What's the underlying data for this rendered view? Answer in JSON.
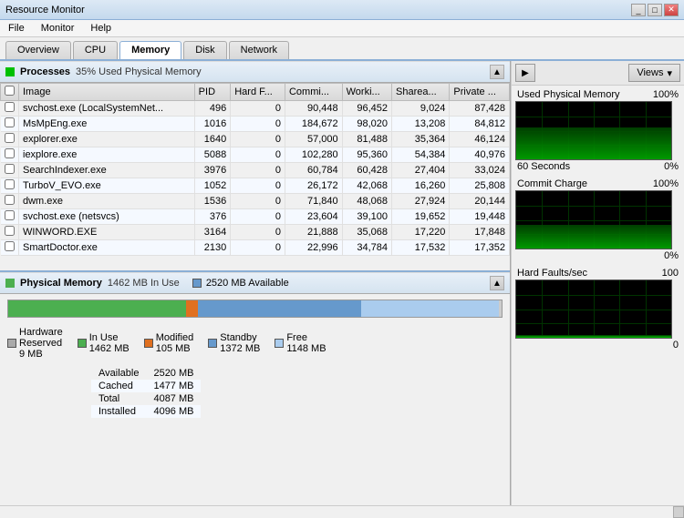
{
  "titleBar": {
    "title": "Resource Monitor",
    "minimizeLabel": "_",
    "maximizeLabel": "□",
    "closeLabel": "✕"
  },
  "menu": {
    "items": [
      "File",
      "Monitor",
      "Help"
    ]
  },
  "tabs": [
    {
      "label": "Overview",
      "active": false
    },
    {
      "label": "CPU",
      "active": false
    },
    {
      "label": "Memory",
      "active": true
    },
    {
      "label": "Disk",
      "active": false
    },
    {
      "label": "Network",
      "active": false
    }
  ],
  "processesSection": {
    "title": "Processes",
    "statusText": "35% Used Physical Memory",
    "columns": [
      "Image",
      "PID",
      "Hard F...",
      "Commi...",
      "Worki...",
      "Sharea...",
      "Private ..."
    ],
    "rows": [
      [
        "svchost.exe (LocalSystemNet...",
        "496",
        "0",
        "90,448",
        "96,452",
        "9,024",
        "87,428"
      ],
      [
        "MsMpEng.exe",
        "1016",
        "0",
        "184,672",
        "98,020",
        "13,208",
        "84,812"
      ],
      [
        "explorer.exe",
        "1640",
        "0",
        "57,000",
        "81,488",
        "35,364",
        "46,124"
      ],
      [
        "iexplore.exe",
        "5088",
        "0",
        "102,280",
        "95,360",
        "54,384",
        "40,976"
      ],
      [
        "SearchIndexer.exe",
        "3976",
        "0",
        "60,784",
        "60,428",
        "27,404",
        "33,024"
      ],
      [
        "TurboV_EVO.exe",
        "1052",
        "0",
        "26,172",
        "42,068",
        "16,260",
        "25,808"
      ],
      [
        "dwm.exe",
        "1536",
        "0",
        "71,840",
        "48,068",
        "27,924",
        "20,144"
      ],
      [
        "svchost.exe (netsvcs)",
        "376",
        "0",
        "23,604",
        "39,100",
        "19,652",
        "19,448"
      ],
      [
        "WINWORD.EXE",
        "3164",
        "0",
        "21,888",
        "35,068",
        "17,220",
        "17,848"
      ],
      [
        "SmartDoctor.exe",
        "2130",
        "0",
        "22,996",
        "34,784",
        "17,532",
        "17,352"
      ]
    ]
  },
  "physicalMemorySection": {
    "title": "Physical Memory",
    "inUseLabel": "1462 MB In Use",
    "availableLabel": "2520 MB Available",
    "legend": [
      {
        "label": "Hardware Reserved",
        "sublabel": "9 MB",
        "color": "#aaaaaa"
      },
      {
        "label": "In Use",
        "sublabel": "1462 MB",
        "color": "#4caf50"
      },
      {
        "label": "Modified",
        "sublabel": "105 MB",
        "color": "#e07020"
      },
      {
        "label": "Standby",
        "sublabel": "1372 MB",
        "color": "#6699cc"
      },
      {
        "label": "Free",
        "sublabel": "1148 MB",
        "color": "#aaccee"
      }
    ],
    "stats": [
      {
        "label": "Available",
        "value": "2520 MB"
      },
      {
        "label": "Cached",
        "value": "1477 MB"
      },
      {
        "label": "Total",
        "value": "4087 MB"
      },
      {
        "label": "Installed",
        "value": "4096 MB"
      }
    ]
  },
  "rightPanel": {
    "viewsLabel": "Views",
    "graphs": [
      {
        "label": "Used Physical Memory",
        "percentage": "100%",
        "duration": "60 Seconds",
        "durationRight": "0%"
      },
      {
        "label": "Commit Charge",
        "percentage": "100%",
        "duration": "",
        "durationRight": "0%"
      },
      {
        "label": "Hard Faults/sec",
        "percentage": "100",
        "duration": "",
        "durationRight": "0"
      }
    ]
  }
}
